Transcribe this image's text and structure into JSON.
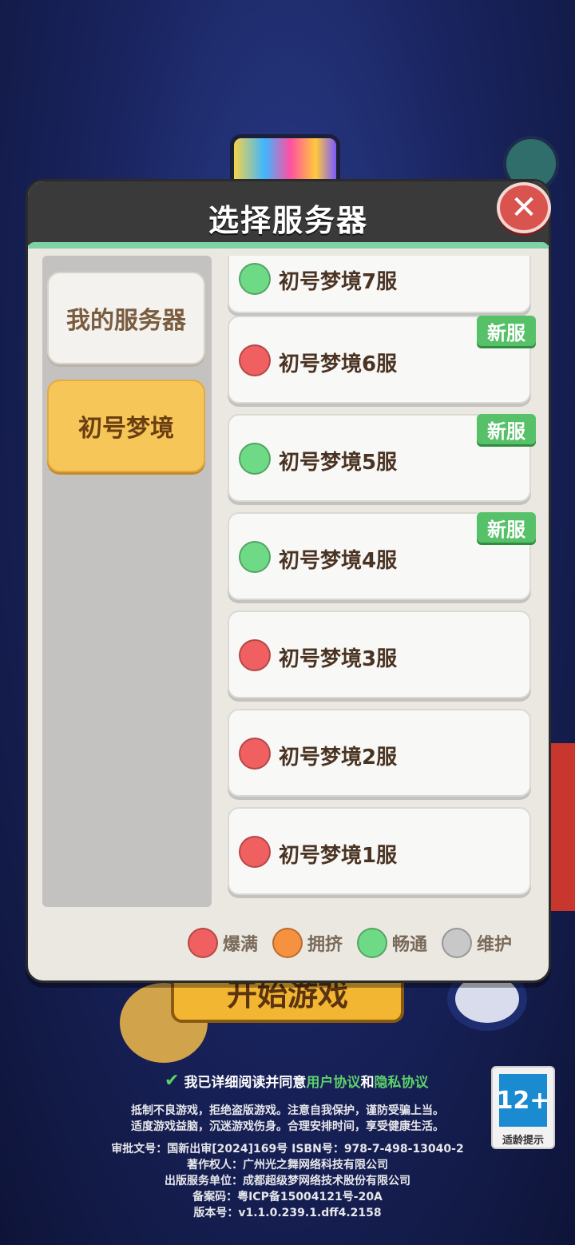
{
  "dialog": {
    "title": "选择服务器",
    "close_icon": "close-icon"
  },
  "sidebar": {
    "items": [
      {
        "label": "我的服务器",
        "active": false
      },
      {
        "label": "初号梦境",
        "active": true
      }
    ]
  },
  "servers": [
    {
      "name": "初号梦境7服",
      "status": "畅通",
      "new": false
    },
    {
      "name": "初号梦境6服",
      "status": "爆满",
      "new": true
    },
    {
      "name": "初号梦境5服",
      "status": "畅通",
      "new": true
    },
    {
      "name": "初号梦境4服",
      "status": "畅通",
      "new": true
    },
    {
      "name": "初号梦境3服",
      "status": "爆满",
      "new": false
    },
    {
      "name": "初号梦境2服",
      "status": "爆满",
      "new": false
    },
    {
      "name": "初号梦境1服",
      "status": "爆满",
      "new": false
    }
  ],
  "new_badge_label": "新服",
  "legend": [
    {
      "label": "爆满",
      "color": "#f06060"
    },
    {
      "label": "拥挤",
      "color": "#f6913f"
    },
    {
      "label": "畅通",
      "color": "#6fda86"
    },
    {
      "label": "维护",
      "color": "#c8c8c8"
    }
  ],
  "background": {
    "start_button_label": "开始游戏"
  },
  "footer": {
    "agree_prefix": "我已详细阅读并同意",
    "user_agreement": "用户协议",
    "and": "和",
    "privacy_agreement": "隐私协议",
    "notice_line1": "抵制不良游戏，拒绝盗版游戏。注意自我保护，谨防受骗上当。",
    "notice_line2": "适度游戏益脑，沉迷游戏伤身。合理安排时间，享受健康生活。",
    "approval": "审批文号：国新出审[2024]169号 ISBN号：978-7-498-13040-2",
    "copyright": "著作权人：广州光之舞网络科技有限公司",
    "publisher": "出版服务单位：成都超级梦网络技术股份有限公司",
    "icp": "备案码：粤ICP备15004121号-20A",
    "version": "版本号：v1.1.0.239.1.dff4.2158"
  },
  "age_rating": {
    "value": "12+",
    "label": "适龄提示"
  },
  "status_colors": {
    "爆满": "#f06060",
    "拥挤": "#f6913f",
    "畅通": "#6fda86",
    "维护": "#c8c8c8"
  }
}
